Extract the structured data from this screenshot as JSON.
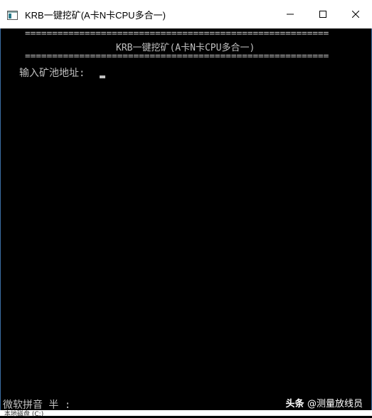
{
  "window": {
    "title": "KRB一键挖矿(A卡N卡CPU多合一)",
    "icon": "console-window-icon"
  },
  "console": {
    "separator_top": "========================================================",
    "heading": "KRB一键挖矿(A卡N卡CPU多合一)",
    "separator_bottom": "========================================================",
    "prompt_label": "输入矿池地址:"
  },
  "ime_status": "微软拼音 半 :",
  "watermark": {
    "brand": "头条",
    "handle": "@测量放线员"
  },
  "taskbar": {
    "partial_label": "本地磁盘 (C:)"
  },
  "colors": {
    "console_bg": "#000000",
    "console_text": "#c0c0c0",
    "titlebar_bg": "#ffffff"
  }
}
